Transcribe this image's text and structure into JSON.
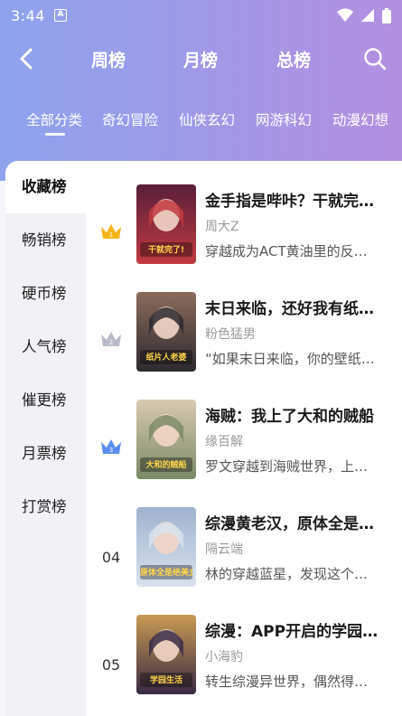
{
  "status_bar": {
    "time": "3:44",
    "app_badge": "A"
  },
  "nav": {
    "tabs": [
      {
        "label": "周榜"
      },
      {
        "label": "月榜"
      },
      {
        "label": "总榜"
      }
    ]
  },
  "categories": [
    {
      "label": "全部分类"
    },
    {
      "label": "奇幻冒险"
    },
    {
      "label": "仙侠玄幻"
    },
    {
      "label": "网游科幻"
    },
    {
      "label": "动漫幻想"
    }
  ],
  "sidebar": {
    "items": [
      {
        "label": "收藏榜"
      },
      {
        "label": "畅销榜"
      },
      {
        "label": "硬币榜"
      },
      {
        "label": "人气榜"
      },
      {
        "label": "催更榜"
      },
      {
        "label": "月票榜"
      },
      {
        "label": "打赏榜"
      }
    ]
  },
  "books": [
    {
      "rank": "1",
      "title": "金手指是哔咔？干就完…",
      "author": "周大Z",
      "desc": "穿越成为ACT黄油里的反…",
      "cover_text": "干就完了!",
      "cover_colors": [
        "#c23a3f",
        "#5a1f3a"
      ]
    },
    {
      "rank": "2",
      "title": "末日来临，还好我有纸…",
      "author": "粉色猛男",
      "desc": "“如果末日来临，你的壁纸…",
      "cover_text": "纸片人老婆",
      "cover_colors": [
        "#2d2a2f",
        "#8a6b5a"
      ]
    },
    {
      "rank": "3",
      "title": "海贼：我上了大和的贼船",
      "author": "缘百解",
      "desc": "罗文穿越到海贼世界，上…",
      "cover_text": "大和的贼船",
      "cover_colors": [
        "#7a8a66",
        "#d8c9b0"
      ]
    },
    {
      "rank": "04",
      "title": "综漫黄老汉，原体全是…",
      "author": "隔云端",
      "desc": "林的穿越蓝星，发现这个…",
      "cover_text": "原体全是绝美女王",
      "cover_colors": [
        "#d8e2ee",
        "#9fb3cf"
      ]
    },
    {
      "rank": "05",
      "title": "综漫：APP开启的学园…",
      "author": "小海豹",
      "desc": "转生综漫异世界，偶然得…",
      "cover_text": "学园生活",
      "cover_colors": [
        "#3a2b46",
        "#c89a52"
      ]
    }
  ],
  "colors": {
    "gold_crown": "#f4b41a",
    "silver_crown": "#b8bcc8",
    "blue_crown": "#5b8df0"
  }
}
